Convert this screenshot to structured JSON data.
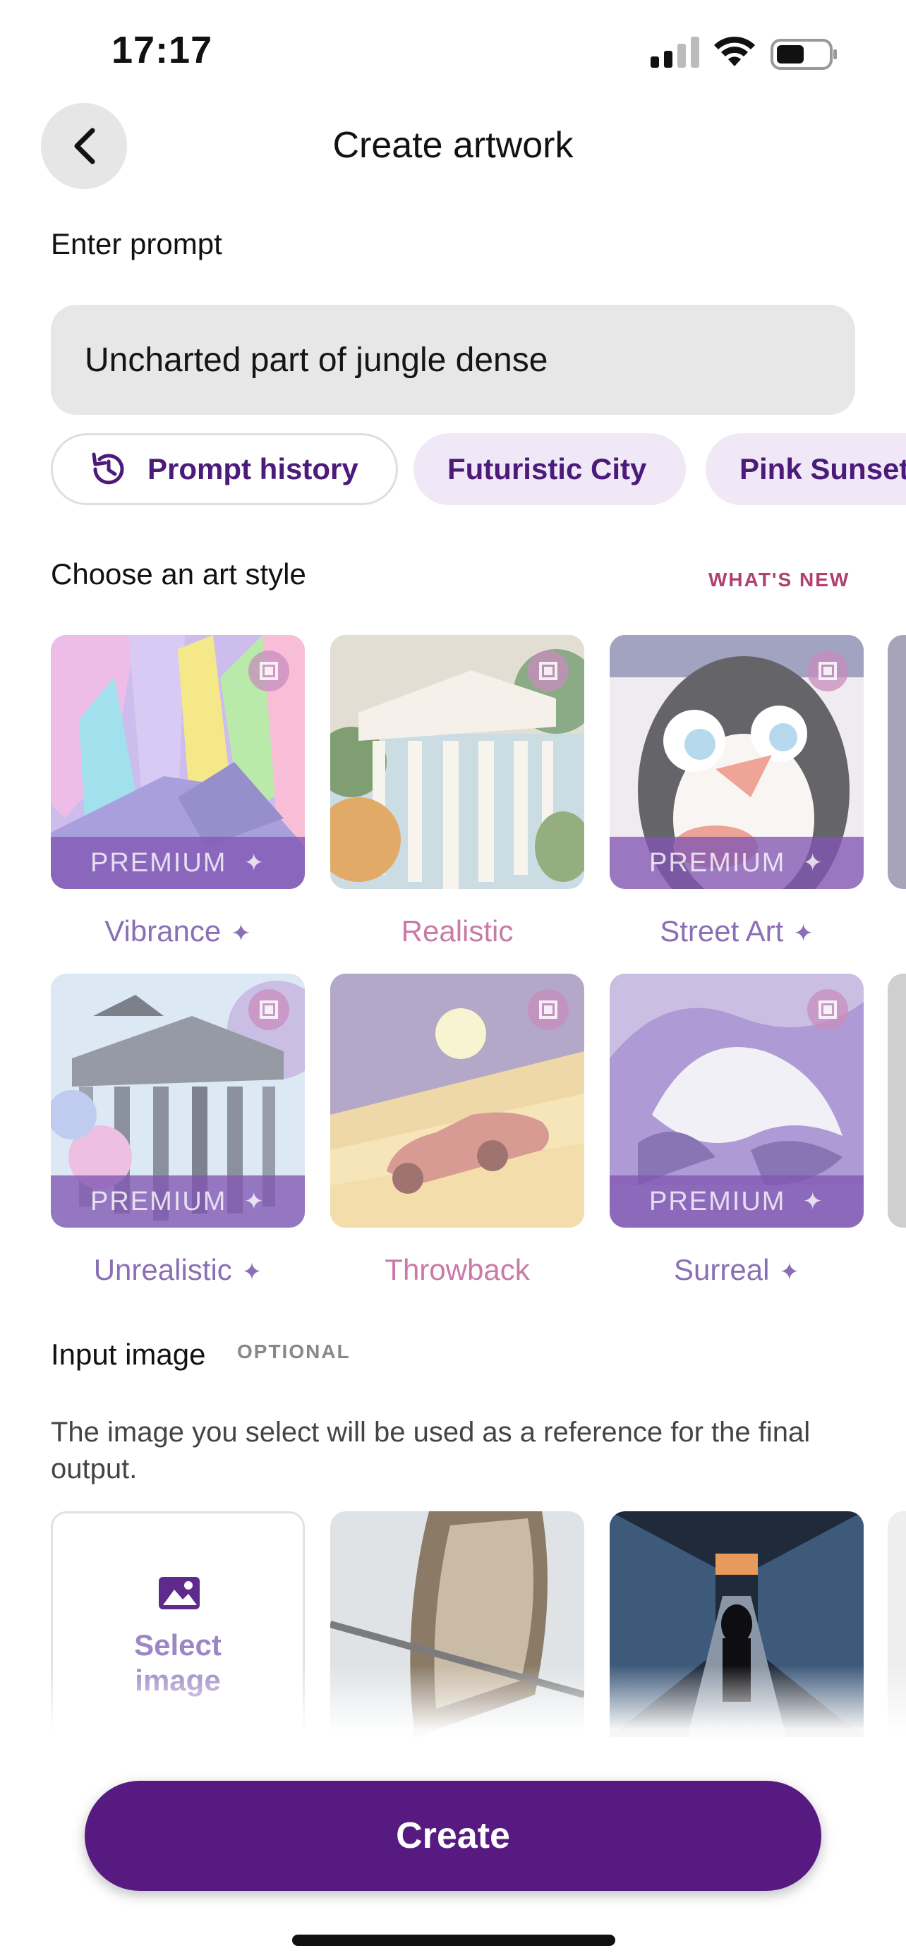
{
  "status": {
    "time": "17:17"
  },
  "header": {
    "title": "Create artwork"
  },
  "prompt": {
    "label": "Enter prompt",
    "value": "Uncharted part of jungle dense"
  },
  "chips": {
    "history": "Prompt history",
    "tags": [
      "Futuristic City",
      "Pink Sunset"
    ]
  },
  "art_style": {
    "label": "Choose an art style",
    "whats_new": "WHAT'S NEW",
    "premium_label": "PREMIUM",
    "items": [
      {
        "name": "Vibrance",
        "premium": true
      },
      {
        "name": "Realistic",
        "premium": false
      },
      {
        "name": "Street Art",
        "premium": true
      },
      {
        "name": "Unrealistic",
        "premium": true
      },
      {
        "name": "Throwback",
        "premium": false
      },
      {
        "name": "Surreal",
        "premium": true
      }
    ]
  },
  "input_image": {
    "label": "Input image",
    "optional": "OPTIONAL",
    "description": "The image you select will be used as a reference for the final output.",
    "select_label": "Select image"
  },
  "actions": {
    "create": "Create"
  },
  "colors": {
    "accent": "#561a80",
    "chip_bg": "#f0e8f6",
    "whats_new": "#b0406e"
  }
}
